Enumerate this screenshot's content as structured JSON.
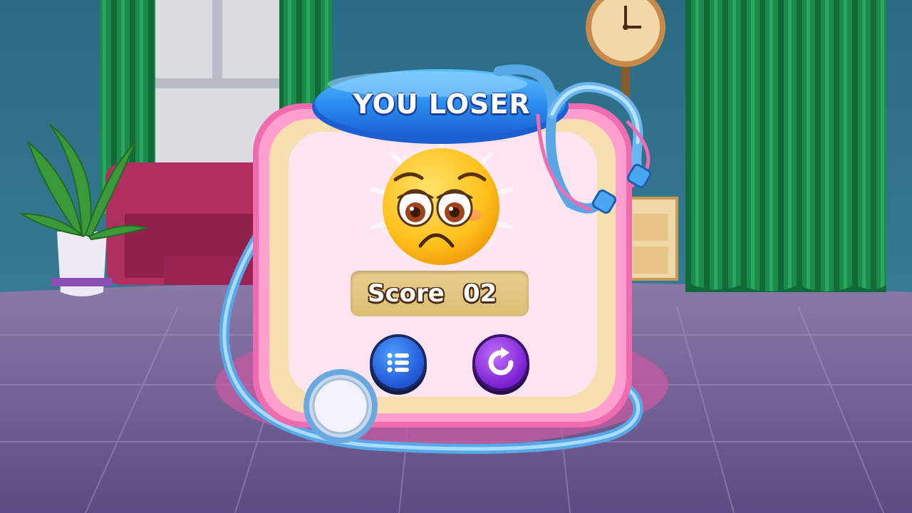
{
  "dialog": {
    "title": "YOU LOSER",
    "score_label": "Score",
    "score_value": "02"
  },
  "buttons": {
    "menu": "list-menu-icon",
    "restart": "restart-icon"
  },
  "colors": {
    "wall": "#2f6f86",
    "floor": "#6b5a8e",
    "curtain": "#1e8a4e",
    "panel_border": "#f07ab8",
    "panel_cream": "#fbe7c0",
    "panel_inner": "#fde3f0",
    "title_banner": "#2f8fe8",
    "menu_button": "#2a66e0",
    "restart_button": "#8a2ee0",
    "emoji": "#ffc21a"
  }
}
